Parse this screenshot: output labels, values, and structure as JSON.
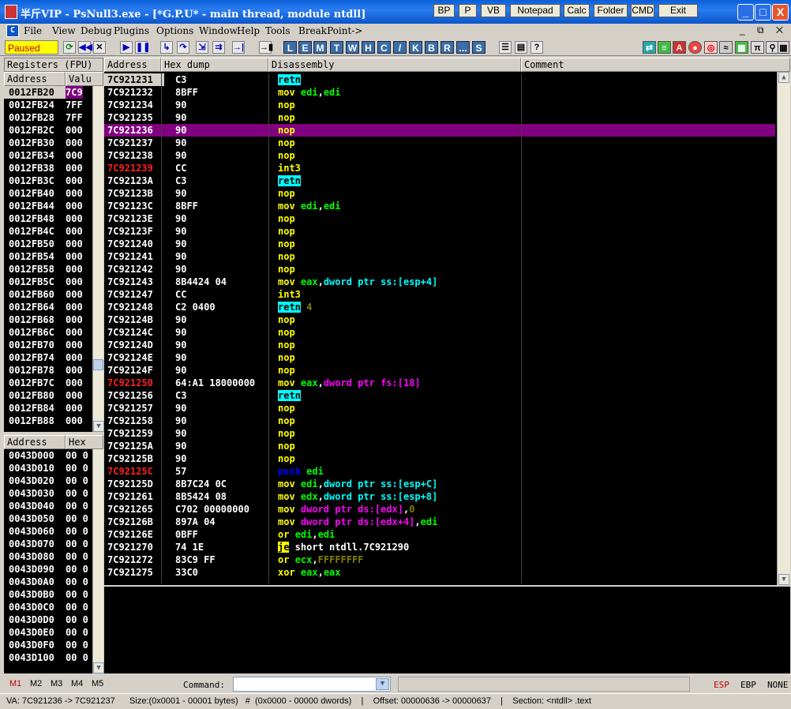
{
  "titlebar": {
    "title": "半斤VIP - PsNull3.exe - [*G.P.U* - main thread, module ntdll]",
    "buttons": [
      "BP",
      "P",
      "VB",
      "Notepad",
      "Calc",
      "Folder",
      "CMD",
      "Exit"
    ],
    "min": "_",
    "max": "□",
    "close": "X"
  },
  "menu": [
    "File",
    "View",
    "Debug",
    "Plugins",
    "Options",
    "Window",
    "Help",
    "Tools",
    "BreakPoint->"
  ],
  "toolbar": {
    "status": "Paused",
    "letters": [
      "L",
      "E",
      "M",
      "T",
      "W",
      "H",
      "C",
      "/",
      "K",
      "B",
      "R",
      "...",
      "S"
    ]
  },
  "registers": {
    "header": "Registers (FPU)",
    "col_address": "Address",
    "col_value": "Valu",
    "rows": [
      {
        "addr": "0012FB20",
        "val": "7C9"
      },
      {
        "addr": "0012FB24",
        "val": "7FF"
      },
      {
        "addr": "0012FB28",
        "val": "7FF"
      },
      {
        "addr": "0012FB2C",
        "val": "000"
      },
      {
        "addr": "0012FB30",
        "val": "000"
      },
      {
        "addr": "0012FB34",
        "val": "000"
      },
      {
        "addr": "0012FB38",
        "val": "000"
      },
      {
        "addr": "0012FB3C",
        "val": "000"
      },
      {
        "addr": "0012FB40",
        "val": "000"
      },
      {
        "addr": "0012FB44",
        "val": "000"
      },
      {
        "addr": "0012FB48",
        "val": "000"
      },
      {
        "addr": "0012FB4C",
        "val": "000"
      },
      {
        "addr": "0012FB50",
        "val": "000"
      },
      {
        "addr": "0012FB54",
        "val": "000"
      },
      {
        "addr": "0012FB58",
        "val": "000"
      },
      {
        "addr": "0012FB5C",
        "val": "000"
      },
      {
        "addr": "0012FB60",
        "val": "000"
      },
      {
        "addr": "0012FB64",
        "val": "000"
      },
      {
        "addr": "0012FB68",
        "val": "000"
      },
      {
        "addr": "0012FB6C",
        "val": "000"
      },
      {
        "addr": "0012FB70",
        "val": "000"
      },
      {
        "addr": "0012FB74",
        "val": "000"
      },
      {
        "addr": "0012FB78",
        "val": "000"
      },
      {
        "addr": "0012FB7C",
        "val": "000"
      },
      {
        "addr": "0012FB80",
        "val": "000"
      },
      {
        "addr": "0012FB84",
        "val": "000"
      },
      {
        "addr": "0012FB88",
        "val": "000"
      }
    ]
  },
  "dump": {
    "col_address": "Address",
    "col_hex": "Hex",
    "rows": [
      {
        "addr": "0043D000",
        "hex": "00 0"
      },
      {
        "addr": "0043D010",
        "hex": "00 0"
      },
      {
        "addr": "0043D020",
        "hex": "00 0"
      },
      {
        "addr": "0043D030",
        "hex": "00 0"
      },
      {
        "addr": "0043D040",
        "hex": "00 0"
      },
      {
        "addr": "0043D050",
        "hex": "00 0"
      },
      {
        "addr": "0043D060",
        "hex": "00 0"
      },
      {
        "addr": "0043D070",
        "hex": "00 0"
      },
      {
        "addr": "0043D080",
        "hex": "00 0"
      },
      {
        "addr": "0043D090",
        "hex": "00 0"
      },
      {
        "addr": "0043D0A0",
        "hex": "00 0"
      },
      {
        "addr": "0043D0B0",
        "hex": "00 0"
      },
      {
        "addr": "0043D0C0",
        "hex": "00 0"
      },
      {
        "addr": "0043D0D0",
        "hex": "00 0"
      },
      {
        "addr": "0043D0E0",
        "hex": "00 0"
      },
      {
        "addr": "0043D0F0",
        "hex": "00 0"
      },
      {
        "addr": "0043D100",
        "hex": "00 0"
      }
    ]
  },
  "disasm": {
    "col_address": "Address",
    "col_hex": "Hex dump",
    "col_dis": "Disassembly",
    "col_comment": "Comment",
    "rows": [
      {
        "addr": "7C921231",
        "hex": "C3",
        "dis": [
          [
            "ret",
            "retn"
          ]
        ],
        "addrstyle": "hl"
      },
      {
        "addr": "7C921232",
        "hex": "8BFF",
        "dis": [
          [
            "mov",
            "mov "
          ],
          [
            "reg",
            "edi"
          ],
          [
            "white",
            ","
          ],
          [
            "reg",
            "edi"
          ]
        ]
      },
      {
        "addr": "7C921234",
        "hex": "90",
        "dis": [
          [
            "nop",
            "nop"
          ]
        ]
      },
      {
        "addr": "7C921235",
        "hex": "90",
        "dis": [
          [
            "nop",
            "nop"
          ]
        ]
      },
      {
        "addr": "7C921236",
        "hex": "90",
        "dis": [
          [
            "nop",
            "nop"
          ]
        ],
        "selected": true
      },
      {
        "addr": "7C921237",
        "hex": "90",
        "dis": [
          [
            "nop",
            "nop"
          ]
        ]
      },
      {
        "addr": "7C921238",
        "hex": "90",
        "dis": [
          [
            "nop",
            "nop"
          ]
        ]
      },
      {
        "addr": "7C921239",
        "hex": "CC",
        "dis": [
          [
            "nop",
            "int3"
          ]
        ],
        "red": true
      },
      {
        "addr": "7C92123A",
        "hex": "C3",
        "dis": [
          [
            "ret",
            "retn"
          ]
        ]
      },
      {
        "addr": "7C92123B",
        "hex": "90",
        "dis": [
          [
            "nop",
            "nop"
          ]
        ]
      },
      {
        "addr": "7C92123C",
        "hex": "8BFF",
        "dis": [
          [
            "mov",
            "mov "
          ],
          [
            "reg",
            "edi"
          ],
          [
            "white",
            ","
          ],
          [
            "reg",
            "edi"
          ]
        ]
      },
      {
        "addr": "7C92123E",
        "hex": "90",
        "dis": [
          [
            "nop",
            "nop"
          ]
        ]
      },
      {
        "addr": "7C92123F",
        "hex": "90",
        "dis": [
          [
            "nop",
            "nop"
          ]
        ]
      },
      {
        "addr": "7C921240",
        "hex": "90",
        "dis": [
          [
            "nop",
            "nop"
          ]
        ]
      },
      {
        "addr": "7C921241",
        "hex": "90",
        "dis": [
          [
            "nop",
            "nop"
          ]
        ]
      },
      {
        "addr": "7C921242",
        "hex": "90",
        "dis": [
          [
            "nop",
            "nop"
          ]
        ]
      },
      {
        "addr": "7C921243",
        "hex": "8B4424 04",
        "dis": [
          [
            "mov",
            "mov "
          ],
          [
            "reg",
            "eax"
          ],
          [
            "white",
            ","
          ],
          [
            "cyan",
            "dword ptr "
          ],
          [
            "seg",
            "ss:[esp+4]"
          ]
        ]
      },
      {
        "addr": "7C921247",
        "hex": "CC",
        "dis": [
          [
            "nop",
            "int3"
          ]
        ]
      },
      {
        "addr": "7C921248",
        "hex": "C2 0400",
        "dis": [
          [
            "ret",
            "retn"
          ],
          [
            "dimnum",
            " 4"
          ]
        ]
      },
      {
        "addr": "7C92124B",
        "hex": "90",
        "dis": [
          [
            "nop",
            "nop"
          ]
        ]
      },
      {
        "addr": "7C92124C",
        "hex": "90",
        "dis": [
          [
            "nop",
            "nop"
          ]
        ]
      },
      {
        "addr": "7C92124D",
        "hex": "90",
        "dis": [
          [
            "nop",
            "nop"
          ]
        ]
      },
      {
        "addr": "7C92124E",
        "hex": "90",
        "dis": [
          [
            "nop",
            "nop"
          ]
        ]
      },
      {
        "addr": "7C92124F",
        "hex": "90",
        "dis": [
          [
            "nop",
            "nop"
          ]
        ]
      },
      {
        "addr": "7C921250",
        "hex": "64:A1 18000000",
        "dis": [
          [
            "mov",
            "mov "
          ],
          [
            "reg",
            "eax"
          ],
          [
            "white",
            ","
          ],
          [
            "mem",
            "dword ptr "
          ],
          [
            "mem",
            "fs:[18]"
          ]
        ],
        "red": true
      },
      {
        "addr": "7C921256",
        "hex": "C3",
        "dis": [
          [
            "ret",
            "retn"
          ]
        ]
      },
      {
        "addr": "7C921257",
        "hex": "90",
        "dis": [
          [
            "nop",
            "nop"
          ]
        ]
      },
      {
        "addr": "7C921258",
        "hex": "90",
        "dis": [
          [
            "nop",
            "nop"
          ]
        ]
      },
      {
        "addr": "7C921259",
        "hex": "90",
        "dis": [
          [
            "nop",
            "nop"
          ]
        ]
      },
      {
        "addr": "7C92125A",
        "hex": "90",
        "dis": [
          [
            "nop",
            "nop"
          ]
        ]
      },
      {
        "addr": "7C92125B",
        "hex": "90",
        "dis": [
          [
            "nop",
            "nop"
          ]
        ]
      },
      {
        "addr": "7C92125C",
        "hex": "57",
        "dis": [
          [
            "push",
            "push "
          ],
          [
            "reg",
            "edi"
          ]
        ],
        "red": true
      },
      {
        "addr": "7C92125D",
        "hex": "8B7C24 0C",
        "dis": [
          [
            "mov",
            "mov "
          ],
          [
            "reg",
            "edi"
          ],
          [
            "white",
            ","
          ],
          [
            "cyan",
            "dword ptr "
          ],
          [
            "seg",
            "ss:[esp+C]"
          ]
        ]
      },
      {
        "addr": "7C921261",
        "hex": "8B5424 08",
        "dis": [
          [
            "mov",
            "mov "
          ],
          [
            "reg",
            "edx"
          ],
          [
            "white",
            ","
          ],
          [
            "cyan",
            "dword ptr "
          ],
          [
            "seg",
            "ss:[esp+8]"
          ]
        ]
      },
      {
        "addr": "7C921265",
        "hex": "C702 00000000",
        "dis": [
          [
            "mov",
            "mov "
          ],
          [
            "mem",
            "dword ptr ds:[edx]"
          ],
          [
            "white",
            ","
          ],
          [
            "dimnum",
            "0"
          ]
        ]
      },
      {
        "addr": "7C92126B",
        "hex": "897A 04",
        "dis": [
          [
            "mov",
            "mov "
          ],
          [
            "mem",
            "dword ptr ds:[edx+4]"
          ],
          [
            "white",
            ","
          ],
          [
            "reg",
            "edi"
          ]
        ]
      },
      {
        "addr": "7C92126E",
        "hex": "0BFF",
        "dis": [
          [
            "mov",
            "or "
          ],
          [
            "reg",
            "edi"
          ],
          [
            "white",
            ","
          ],
          [
            "reg",
            "edi"
          ]
        ]
      },
      {
        "addr": "7C921270",
        "hex": "74 1E",
        "dis": [
          [
            "jmp",
            "je"
          ],
          [
            "white",
            " short ntdll.7C921290"
          ]
        ],
        "jumparrow": "⌄"
      },
      {
        "addr": "7C921272",
        "hex": "83C9 FF",
        "dis": [
          [
            "mov",
            "or "
          ],
          [
            "reg",
            "ecx"
          ],
          [
            "white",
            ","
          ],
          [
            "dimnum",
            "FFFFFFFF"
          ]
        ]
      },
      {
        "addr": "7C921275",
        "hex": "33C0",
        "dis": [
          [
            "mov",
            "xor "
          ],
          [
            "reg",
            "eax"
          ],
          [
            "white",
            ","
          ],
          [
            "reg",
            "eax"
          ]
        ]
      }
    ]
  },
  "cmdbar": {
    "tabs": [
      "M1",
      "M2",
      "M3",
      "M4",
      "M5"
    ],
    "label": "Command:",
    "value": "",
    "regs": [
      "ESP",
      "EBP",
      "NONE"
    ]
  },
  "status": "VA: 7C921236 -> 7C921237      Size:(0x0001 - 00001 bytes)   #  (0x0000 - 00000 dwords)    |    Offset: 00000636 -> 00000637    |    Section: <ntdll> .text",
  "colors": {
    "selection": "#800080",
    "mnemonic": "#ffff00",
    "register": "#00ff00",
    "memory": "#ff00ff",
    "return": "#00ffff",
    "redaddr": "#ff2020"
  }
}
